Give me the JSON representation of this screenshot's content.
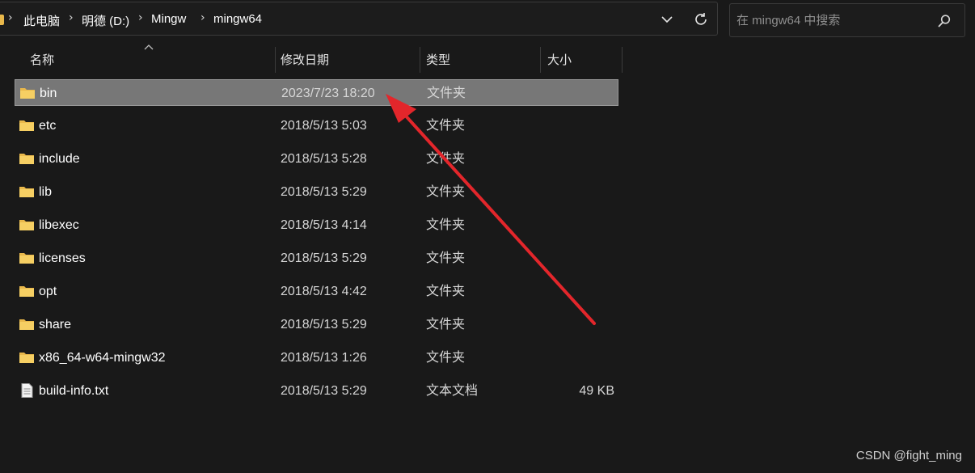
{
  "breadcrumb": {
    "items": [
      "此电脑",
      "明德 (D:)",
      "Mingw",
      "mingw64"
    ]
  },
  "search": {
    "placeholder": "在 mingw64 中搜索",
    "value": ""
  },
  "columns": {
    "name": "名称",
    "date": "修改日期",
    "type": "类型",
    "size": "大小"
  },
  "files": [
    {
      "name": "bin",
      "date": "2023/7/23 18:20",
      "type": "文件夹",
      "size": "",
      "icon": "folder-icon",
      "selected": true
    },
    {
      "name": "etc",
      "date": "2018/5/13 5:03",
      "type": "文件夹",
      "size": "",
      "icon": "folder-icon"
    },
    {
      "name": "include",
      "date": "2018/5/13 5:28",
      "type": "文件夹",
      "size": "",
      "icon": "folder-icon"
    },
    {
      "name": "lib",
      "date": "2018/5/13 5:29",
      "type": "文件夹",
      "size": "",
      "icon": "folder-icon"
    },
    {
      "name": "libexec",
      "date": "2018/5/13 4:14",
      "type": "文件夹",
      "size": "",
      "icon": "folder-icon"
    },
    {
      "name": "licenses",
      "date": "2018/5/13 5:29",
      "type": "文件夹",
      "size": "",
      "icon": "folder-icon"
    },
    {
      "name": "opt",
      "date": "2018/5/13 4:42",
      "type": "文件夹",
      "size": "",
      "icon": "folder-icon"
    },
    {
      "name": "share",
      "date": "2018/5/13 5:29",
      "type": "文件夹",
      "size": "",
      "icon": "folder-icon"
    },
    {
      "name": "x86_64-w64-mingw32",
      "date": "2018/5/13 1:26",
      "type": "文件夹",
      "size": "",
      "icon": "folder-icon"
    },
    {
      "name": "build-info.txt",
      "date": "2018/5/13 5:29",
      "type": "文本文档",
      "size": "49 KB",
      "icon": "text-file-icon"
    }
  ],
  "watermark": "CSDN @fight_ming",
  "colors": {
    "background": "#191919",
    "selection": "#777777",
    "folder": "#e9b84b",
    "annotation_arrow": "#e3262b"
  }
}
